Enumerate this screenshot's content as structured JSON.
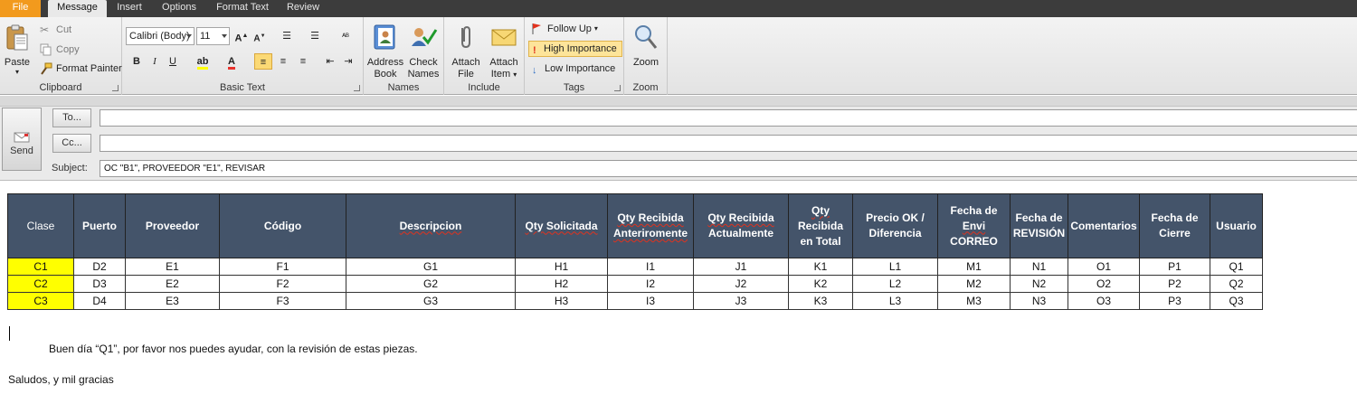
{
  "tabs": [
    {
      "label": "File"
    },
    {
      "label": "Message"
    },
    {
      "label": "Insert"
    },
    {
      "label": "Options"
    },
    {
      "label": "Format Text"
    },
    {
      "label": "Review"
    }
  ],
  "clipboard": {
    "paste": "Paste",
    "cut": "Cut",
    "copy": "Copy",
    "format_painter": "Format Painter",
    "label": "Clipboard"
  },
  "basic_text": {
    "font_name": "Calibri (Body)",
    "font_size": "11",
    "bold": "B",
    "italic": "I",
    "underline": "U",
    "label": "Basic Text"
  },
  "names": {
    "address_book_1": "Address",
    "address_book_2": "Book",
    "check_names_1": "Check",
    "check_names_2": "Names",
    "label": "Names"
  },
  "include": {
    "attach_file_1": "Attach",
    "attach_file_2": "File",
    "attach_item_1": "Attach",
    "attach_item_2": "Item",
    "label": "Include"
  },
  "tags": {
    "follow_up": "Follow Up",
    "high_importance": "High Importance",
    "low_importance": "Low Importance",
    "label": "Tags"
  },
  "zoom": {
    "button": "Zoom",
    "label": "Zoom"
  },
  "header": {
    "send": "Send",
    "to_button": "To...",
    "cc_button": "Cc...",
    "to_value": "",
    "cc_value": "",
    "subject_label": "Subject:",
    "subject_value": "OC \"B1\", PROVEEDOR \"E1\", REVISAR"
  },
  "table": {
    "headers": [
      [
        "Clase"
      ],
      [
        "Puerto"
      ],
      [
        "Proveedor"
      ],
      [
        "Código"
      ],
      [
        "Descripcion"
      ],
      [
        "Qty Solicitada"
      ],
      [
        "Qty Recibida",
        "Anteriromente"
      ],
      [
        "Qty Recibida",
        "Actualmente"
      ],
      [
        "Qty",
        "Recibida",
        "en Total"
      ],
      [
        "Precio  OK /",
        "Diferencia"
      ],
      [
        "Fecha de",
        "Envi",
        "CORREO"
      ],
      [
        "Fecha de",
        "REVISIÓN"
      ],
      [
        "Comentarios"
      ],
      [
        "Fecha de",
        "Cierre"
      ],
      [
        "Usuario"
      ]
    ],
    "rows": [
      [
        "C1",
        "D2",
        "E1",
        "F1",
        "G1",
        "H1",
        "I1",
        "J1",
        "K1",
        "L1",
        "M1",
        "N1",
        "O1",
        "P1",
        "Q1"
      ],
      [
        "C2",
        "D3",
        "E2",
        "F2",
        "G2",
        "H2",
        "I2",
        "J2",
        "K2",
        "L2",
        "M2",
        "N2",
        "O2",
        "P2",
        "Q2"
      ],
      [
        "C3",
        "D4",
        "E3",
        "F3",
        "G3",
        "H3",
        "I3",
        "J3",
        "K3",
        "L3",
        "M3",
        "N3",
        "O3",
        "P3",
        "Q3"
      ]
    ]
  },
  "message": {
    "line1": "Buen día “Q1”, por favor nos puedes ayudar, con la revisión de estas piezas.",
    "line2": "Saludos, y mil gracias"
  },
  "colors": {
    "file_tab": "#f29a1d",
    "table_header": "#44546a",
    "highlight": "#ffff00"
  }
}
